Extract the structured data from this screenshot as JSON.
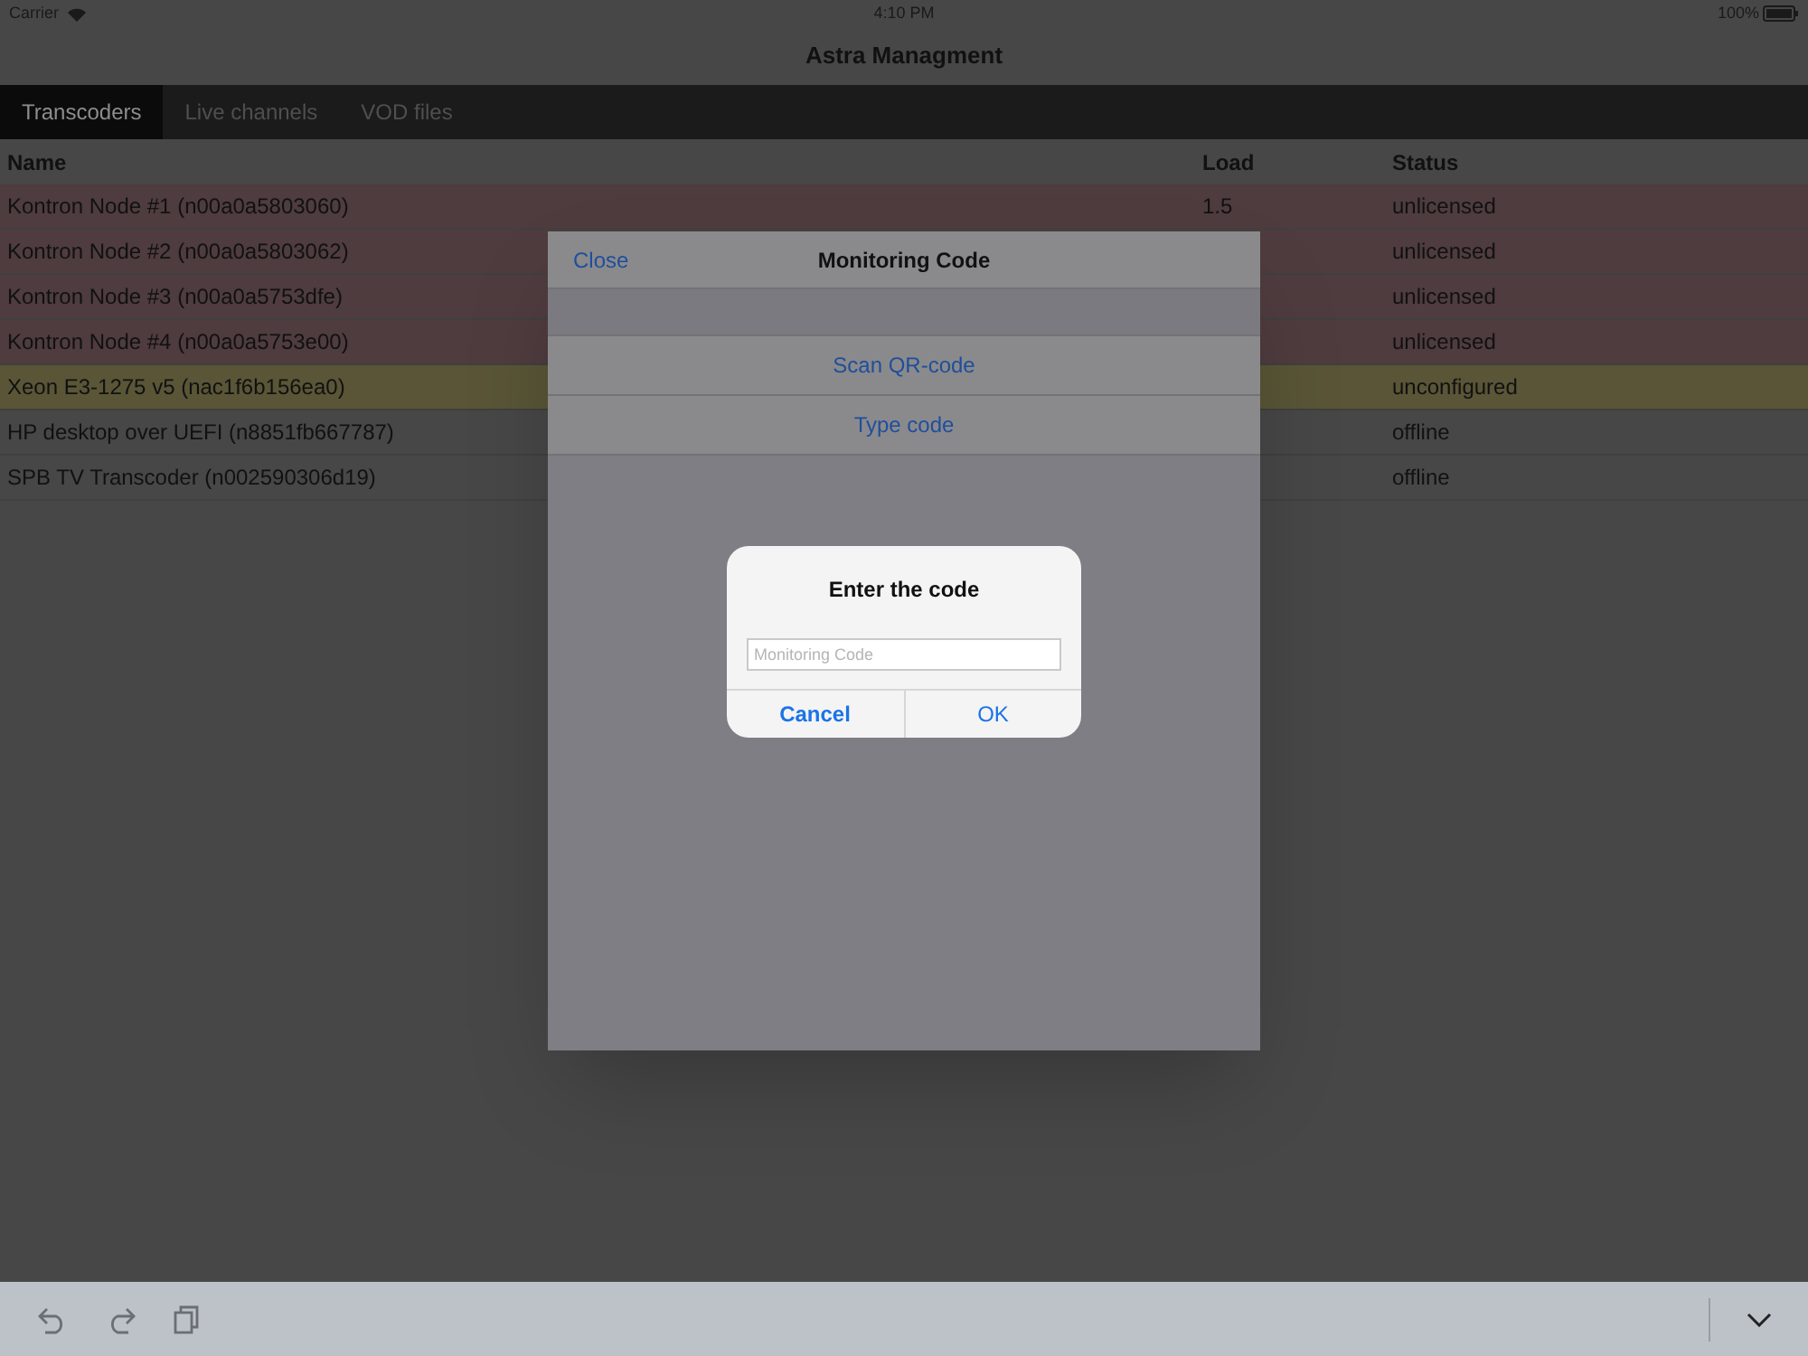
{
  "status_bar": {
    "carrier": "Carrier",
    "time": "4:10 PM",
    "battery": "100%"
  },
  "nav": {
    "title": "Astra Managment"
  },
  "tabs": [
    {
      "label": "Transcoders",
      "selected": true
    },
    {
      "label": "Live channels",
      "selected": false
    },
    {
      "label": "VOD files",
      "selected": false
    }
  ],
  "table": {
    "columns": [
      "Name",
      "Load",
      "Status"
    ],
    "rows": [
      {
        "name": "Kontron Node #1 (n00a0a5803060)",
        "load": "1.5",
        "status": "unlicensed",
        "color": "#4f3c3e"
      },
      {
        "name": "Kontron Node #2 (n00a0a5803062)",
        "status": "unlicensed",
        "color": "#4f3c3e"
      },
      {
        "name": "Kontron Node #3 (n00a0a5753dfe)",
        "status": "unlicensed",
        "color": "#4f3c3e"
      },
      {
        "name": "Kontron Node #4 (n00a0a5753e00)",
        "status": "unlicensed",
        "color": "#4f3c3e"
      },
      {
        "name": "Xeon E3-1275 v5 (nac1f6b156ea0)",
        "status": "unconfigured",
        "color": "#595536"
      },
      {
        "name": "HP desktop over UEFI (n8851fb667787)",
        "status": "offline",
        "color": "#474747"
      },
      {
        "name": "SPB TV Transcoder (n002590306d19)",
        "status": "offline",
        "color": "#474747"
      }
    ]
  },
  "sheet": {
    "close": "Close",
    "title": "Monitoring Code",
    "options": [
      "Scan QR-code",
      "Type code"
    ]
  },
  "alert": {
    "title": "Enter the code",
    "placeholder": "Monitoring Code",
    "buttons": [
      "Cancel",
      "OK"
    ]
  }
}
